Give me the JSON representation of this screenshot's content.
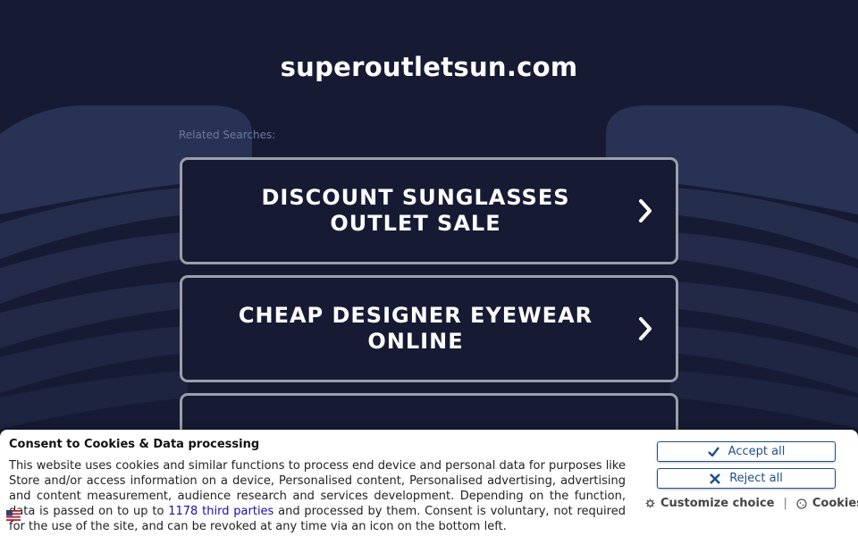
{
  "site": {
    "domain": "superoutletsun.com"
  },
  "related": {
    "label": "Related Searches:"
  },
  "searches": [
    {
      "label": "DISCOUNT SUNGLASSES OUTLET SALE"
    },
    {
      "label": "CHEAP DESIGNER EYEWEAR ONLINE"
    },
    {
      "label": ""
    }
  ],
  "consent": {
    "title": "Consent to Cookies & Data processing",
    "text_before_link": "This website uses cookies and similar functions to process end device and personal data for purposes like Store and/or access information on a device, Personalised content, Personalised advertising, advertising and content measurement, audience research and services development. Depending on the function, data is passed on to up to ",
    "link_text": "1178 third parties",
    "text_after_link": " and processed by them. Consent is voluntary, not required for the use of the site, and can be revoked at any time via an icon on the bottom left.",
    "accept_label": "Accept all",
    "reject_label": "Reject all",
    "customize_label": "Customize choice",
    "separator": "|",
    "cookies_label": "Cookies"
  },
  "colors": {
    "background": "#161b33",
    "button_border": "#9aa0a8",
    "consent_accent": "#1f4e8c",
    "link": "#1a0dab"
  },
  "icons": [
    "chevron-right-icon",
    "check-icon",
    "x-icon",
    "gear-icon",
    "cookie-icon",
    "flag-icon"
  ]
}
